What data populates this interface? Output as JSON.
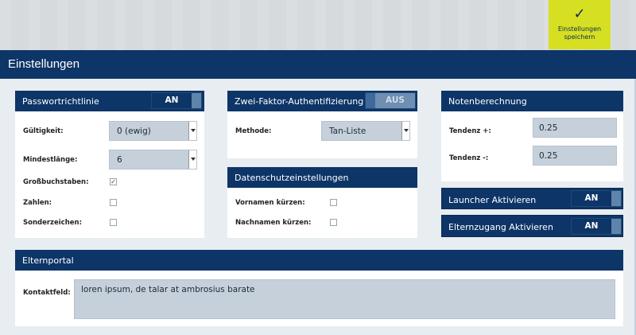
{
  "save": {
    "label_line1": "Einstellungen",
    "label_line2": "speichern",
    "icon": "check-icon"
  },
  "header": {
    "title": "Einstellungen"
  },
  "password_policy": {
    "title": "Passwortrichtlinie",
    "toggle": "AN",
    "validity_label": "Gültigkeit:",
    "validity_value": "0 (ewig)",
    "min_length_label": "Mindestlänge:",
    "min_length_value": "6",
    "uppercase_label": "Großbuchstaben:",
    "uppercase_checked": true,
    "numbers_label": "Zahlen:",
    "numbers_checked": false,
    "special_label": "Sonderzeichen:",
    "special_checked": false
  },
  "two_factor": {
    "title": "Zwei-Faktor-Authentifizierung",
    "toggle": "AUS",
    "method_label": "Methode:",
    "method_value": "Tan-Liste"
  },
  "privacy": {
    "title": "Datenschutzeinstellungen",
    "firstname_label": "Vornamen kürzen:",
    "firstname_checked": false,
    "lastname_label": "Nachnamen kürzen:",
    "lastname_checked": false
  },
  "grading": {
    "title": "Notenberechnung",
    "plus_label": "Tendenz +:",
    "plus_value": "0.25",
    "minus_label": "Tendenz -:",
    "minus_value": "0.25"
  },
  "launcher": {
    "title": "Launcher Aktivieren",
    "toggle": "AN"
  },
  "parent_access": {
    "title": "Elternzugang Aktivieren",
    "toggle": "AN"
  },
  "parent_portal": {
    "title": "Elternportal",
    "contact_label": "Kontaktfeld:",
    "contact_value": "loren ipsum, de talar at ambrosius barate"
  },
  "colors": {
    "navy": "#0d3567",
    "accent": "#d6df22",
    "field": "#c6d0db"
  }
}
